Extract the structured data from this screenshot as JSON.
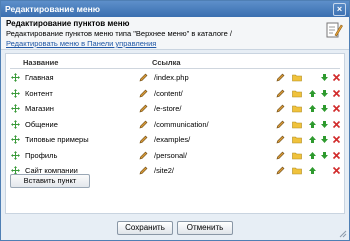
{
  "window": {
    "title": "Редактирование меню"
  },
  "header": {
    "title": "Редактирование пунктов меню",
    "description": "Редактирование пунктов меню типа \"Верхнее меню\" в каталоге /",
    "control_panel_link": "Редактировать меню в Панели управления"
  },
  "table": {
    "col_name": "Название",
    "col_link": "Ссылка",
    "rows": [
      {
        "name": "Главная",
        "link": "/index.php"
      },
      {
        "name": "Контент",
        "link": "/content/"
      },
      {
        "name": "Магазин",
        "link": "/e-store/"
      },
      {
        "name": "Общение",
        "link": "/communication/"
      },
      {
        "name": "Типовые примеры",
        "link": "/examples/"
      },
      {
        "name": "Профиль",
        "link": "/personal/"
      },
      {
        "name": "Сайт компании",
        "link": "/site2/"
      }
    ]
  },
  "buttons": {
    "insert": "Вставить пункт",
    "save": "Сохранить",
    "cancel": "Отменить"
  },
  "colors": {
    "accent": "#3a6fb0",
    "link": "#1f57a6",
    "up_arrow": "#2e9a2e",
    "delete": "#d12b2b",
    "folder": "#f0c23c"
  }
}
